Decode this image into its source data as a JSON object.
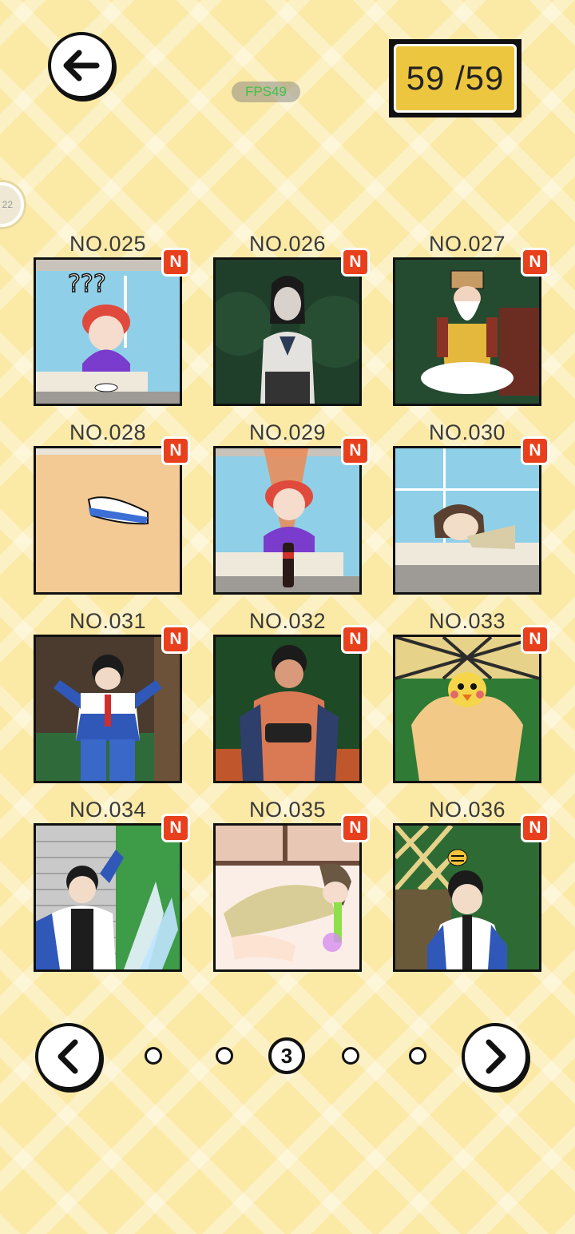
{
  "header": {
    "back_icon": "arrow-left-icon",
    "fps_text": "FPS49",
    "counter_text": "59 /59"
  },
  "side_tab": {
    "text": "22"
  },
  "cards": [
    {
      "label": "NO.025",
      "badge": "N"
    },
    {
      "label": "NO.026",
      "badge": "N"
    },
    {
      "label": "NO.027",
      "badge": "N"
    },
    {
      "label": "NO.028",
      "badge": "N"
    },
    {
      "label": "NO.029",
      "badge": "N"
    },
    {
      "label": "NO.030",
      "badge": "N"
    },
    {
      "label": "NO.031",
      "badge": "N"
    },
    {
      "label": "NO.032",
      "badge": "N"
    },
    {
      "label": "NO.033",
      "badge": "N"
    },
    {
      "label": "NO.034",
      "badge": "N"
    },
    {
      "label": "NO.035",
      "badge": "N"
    },
    {
      "label": "NO.036",
      "badge": "N"
    }
  ],
  "pager": {
    "prev_icon": "chevron-left-icon",
    "next_icon": "chevron-right-icon",
    "current_page": "3",
    "total_dots": 5
  },
  "colors": {
    "background": "#fbe9a6",
    "counter_fill": "#ecc63f",
    "badge": "#e8401c",
    "fps_text": "#43c04a"
  }
}
